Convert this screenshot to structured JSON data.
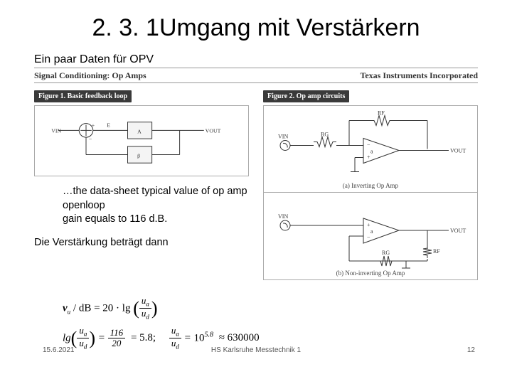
{
  "title": "2. 3. 1Umgang mit Verstärkern",
  "subtitle": "Ein paar Daten für OPV",
  "banner": {
    "left": "Signal Conditioning: Op Amps",
    "right": "Texas Instruments Incorporated"
  },
  "fig1": {
    "label": "Figure 1. Basic feedback loop",
    "vin": "VIN",
    "e": "E",
    "a": "A",
    "beta": "β",
    "vout": "VOUT"
  },
  "fig2": {
    "label": "Figure 2. Op amp circuits",
    "vin": "VIN",
    "rg": "RG",
    "rf": "RF",
    "a": "a",
    "vout": "VOUT",
    "cap_a": "(a) Inverting Op Amp",
    "cap_b": "(b) Non-inverting Op Amp"
  },
  "quote": "…the data-sheet typical value of op amp openloop\ngain equals to 116 d.B.",
  "note": "Die Verstärkung beträgt dann",
  "formula": {
    "vu": "v",
    "u_sub": "u",
    "db": "/ dB = 20 · lg",
    "ua": "u",
    "a_sub": "a",
    "ud": "u",
    "d_sub": "d",
    "eq2_lhs_num": "116",
    "eq2_lhs_den": "20",
    "eq2_mid": "= 5.8;",
    "eq2_pow": "5.8",
    "eq2_rhs": "≈ 630000",
    "ten": "10",
    "approx": "≈"
  },
  "footer": {
    "date": "15.6.2021",
    "center": "HS Karlsruhe Messtechnik 1",
    "right": "12"
  }
}
